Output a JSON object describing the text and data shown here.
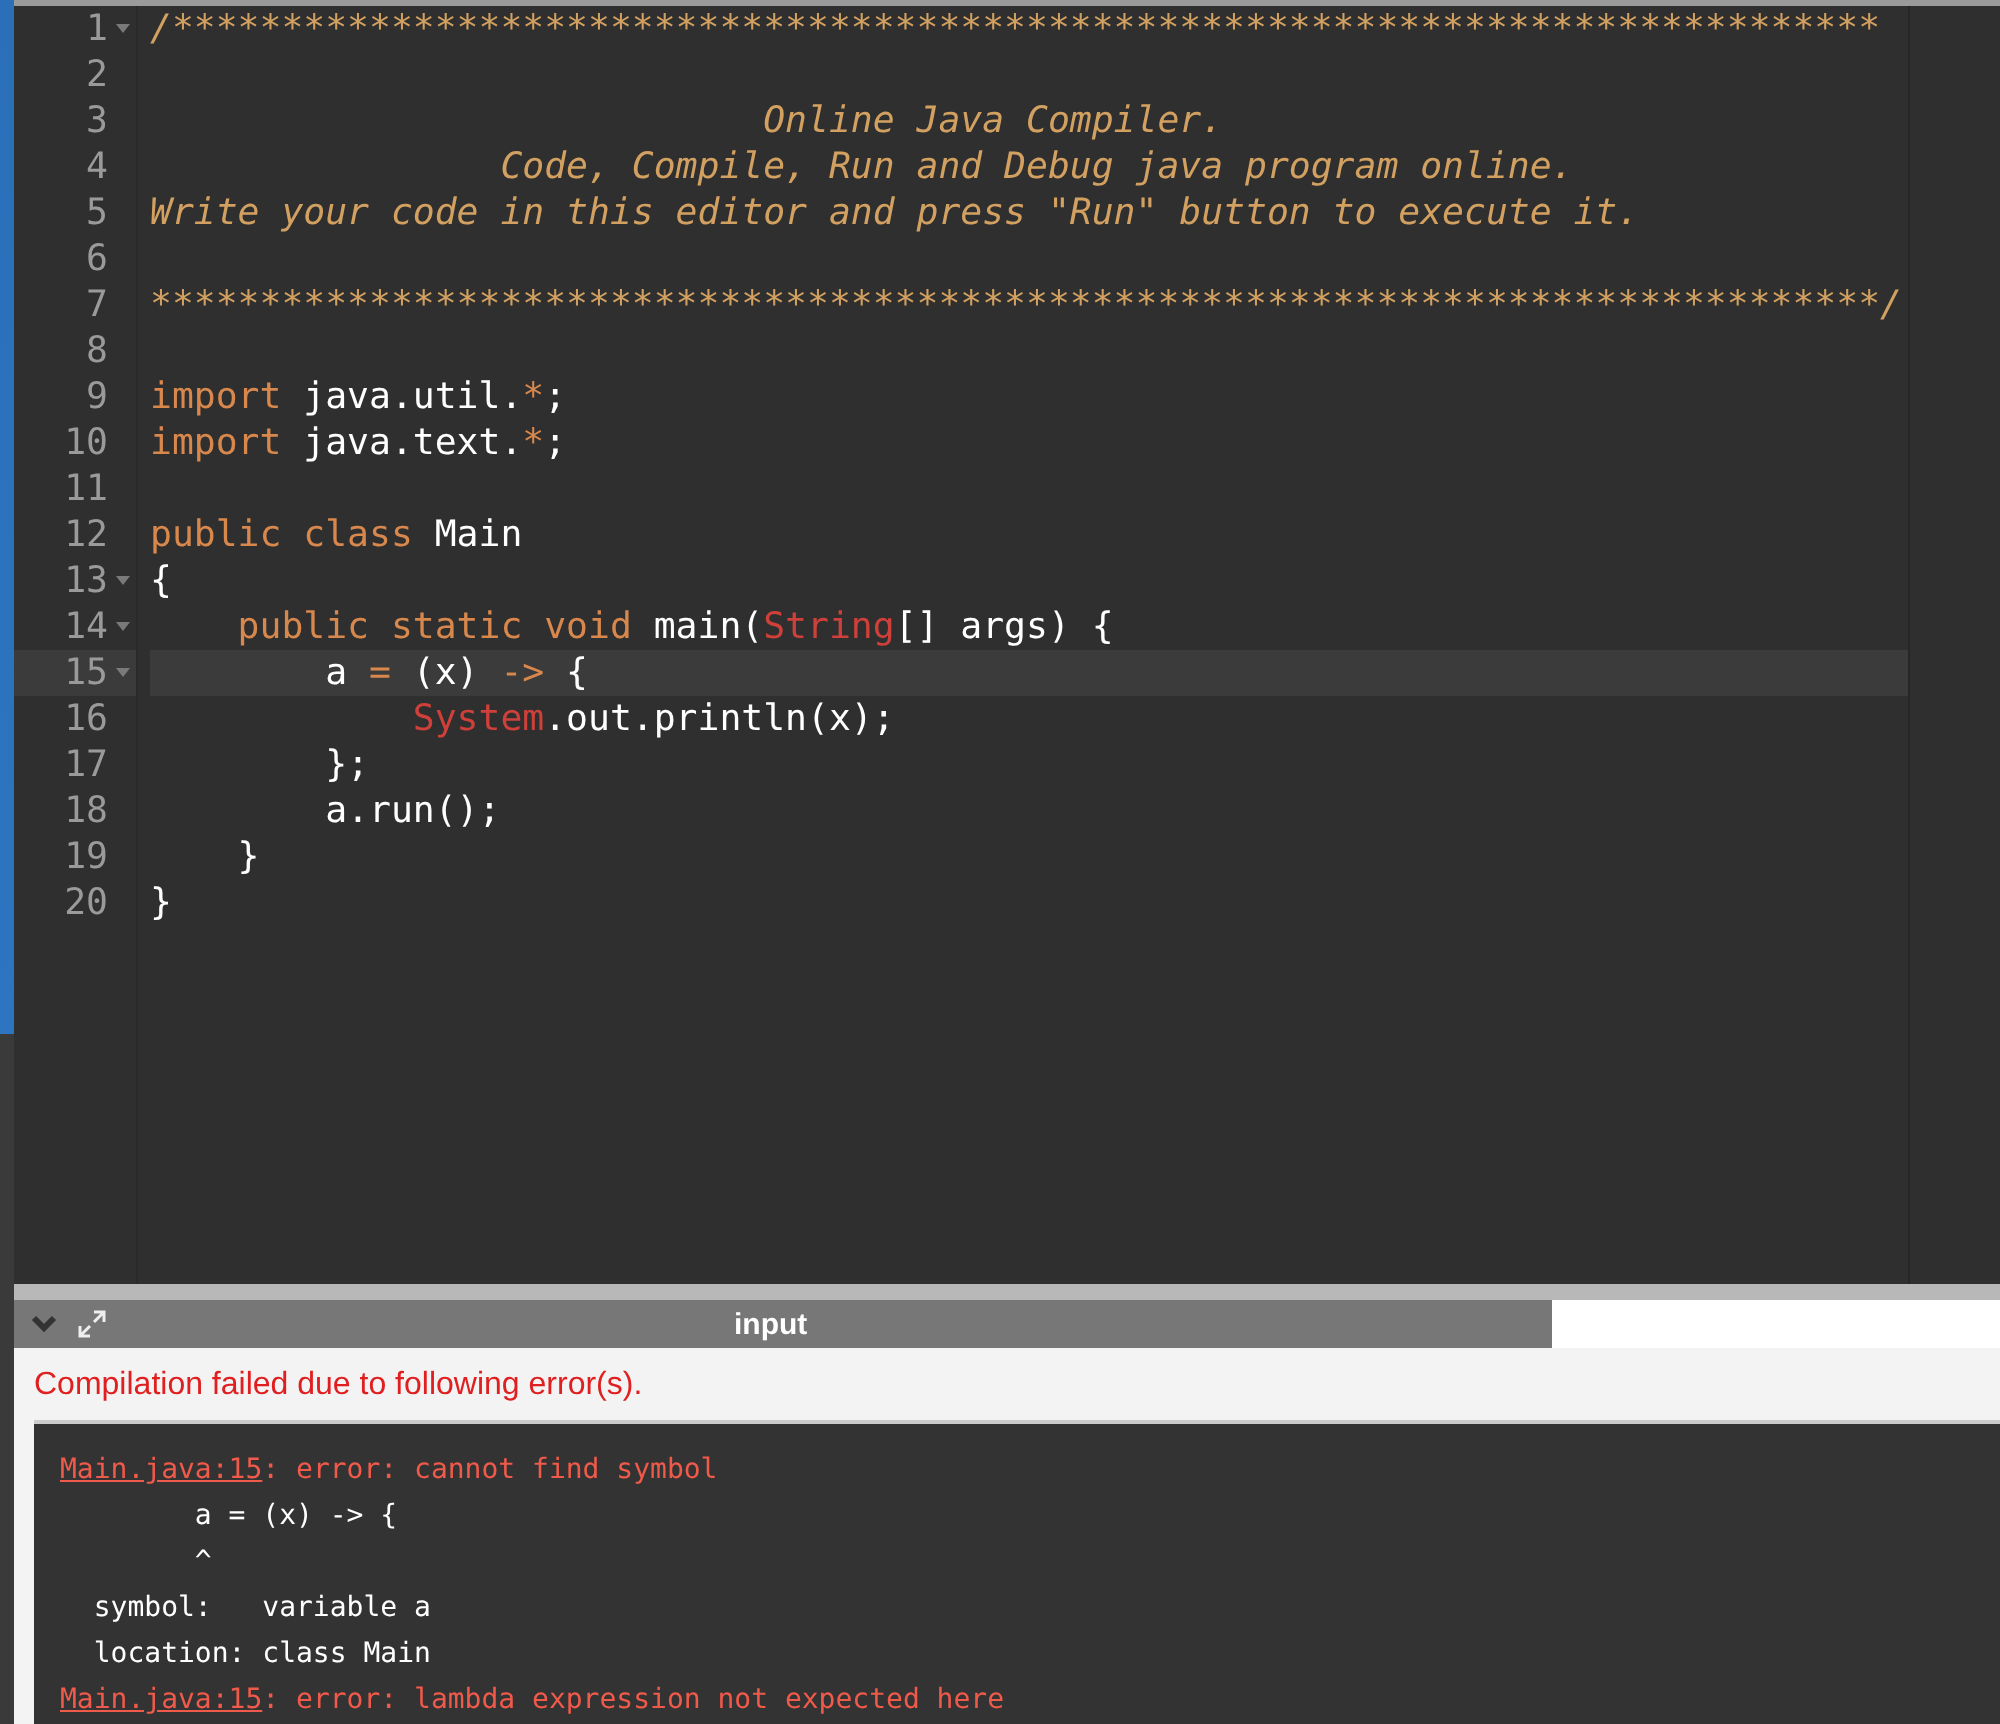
{
  "editor": {
    "lines": [
      {
        "number": "1",
        "foldable": true,
        "active": false,
        "tokens": [
          {
            "kind": "comment",
            "text": "/******************************************************************************"
          }
        ]
      },
      {
        "number": "2",
        "foldable": false,
        "active": false
      },
      {
        "number": "3",
        "foldable": false,
        "active": false,
        "tokens": [
          {
            "kind": "comment",
            "text": "                            Online Java Compiler."
          }
        ]
      },
      {
        "number": "4",
        "foldable": false,
        "active": false,
        "tokens": [
          {
            "kind": "comment",
            "text": "                Code, Compile, Run and Debug java program online."
          }
        ]
      },
      {
        "number": "5",
        "foldable": false,
        "active": false,
        "tokens": [
          {
            "kind": "comment",
            "text": "Write your code in this editor and press \"Run\" button to execute it."
          }
        ]
      },
      {
        "number": "6",
        "foldable": false,
        "active": false
      },
      {
        "number": "7",
        "foldable": false,
        "active": false,
        "tokens": [
          {
            "kind": "comment",
            "text": "*******************************************************************************/"
          }
        ]
      },
      {
        "number": "8",
        "foldable": false,
        "active": false
      },
      {
        "number": "9",
        "foldable": false,
        "active": false,
        "tokens": [
          {
            "kind": "keyword",
            "text": "import"
          },
          {
            "kind": "plain",
            "text": " java.util."
          },
          {
            "kind": "operator",
            "text": "*"
          },
          {
            "kind": "plain",
            "text": ";"
          }
        ]
      },
      {
        "number": "10",
        "foldable": false,
        "active": false,
        "tokens": [
          {
            "kind": "keyword",
            "text": "import"
          },
          {
            "kind": "plain",
            "text": " java.text."
          },
          {
            "kind": "operator",
            "text": "*"
          },
          {
            "kind": "plain",
            "text": ";"
          }
        ]
      },
      {
        "number": "11",
        "foldable": false,
        "active": false
      },
      {
        "number": "12",
        "foldable": false,
        "active": false,
        "tokens": [
          {
            "kind": "keyword",
            "text": "public class"
          },
          {
            "kind": "plain",
            "text": " Main"
          }
        ]
      },
      {
        "number": "13",
        "foldable": true,
        "active": false,
        "tokens": [
          {
            "kind": "plain",
            "text": "{"
          }
        ]
      },
      {
        "number": "14",
        "foldable": true,
        "active": false,
        "tokens": [
          {
            "kind": "keyword",
            "text": "    public static void"
          },
          {
            "kind": "plain",
            "text": " main("
          },
          {
            "kind": "type",
            "text": "String"
          },
          {
            "kind": "plain",
            "text": "[] args) {"
          }
        ]
      },
      {
        "number": "15",
        "foldable": true,
        "active": true,
        "tokens": [
          {
            "kind": "plain",
            "text": "        a "
          },
          {
            "kind": "operator",
            "text": "="
          },
          {
            "kind": "plain",
            "text": " (x) "
          },
          {
            "kind": "operator",
            "text": "->"
          },
          {
            "kind": "plain",
            "text": " {"
          }
        ]
      },
      {
        "number": "16",
        "foldable": false,
        "active": false,
        "tokens": [
          {
            "kind": "type",
            "text": "            System"
          },
          {
            "kind": "plain",
            "text": ".out.println(x);"
          }
        ]
      },
      {
        "number": "17",
        "foldable": false,
        "active": false,
        "tokens": [
          {
            "kind": "plain",
            "text": "        };"
          }
        ]
      },
      {
        "number": "18",
        "foldable": false,
        "active": false,
        "tokens": [
          {
            "kind": "plain",
            "text": "        a.run();"
          }
        ]
      },
      {
        "number": "19",
        "foldable": false,
        "active": false,
        "tokens": [
          {
            "kind": "plain",
            "text": "    }"
          }
        ]
      },
      {
        "number": "20",
        "foldable": false,
        "active": false,
        "tokens": [
          {
            "kind": "plain",
            "text": "}"
          }
        ]
      }
    ]
  },
  "panel": {
    "title": "input"
  },
  "output": {
    "status": "Compilation failed due to following error(s).",
    "lines": [
      [
        {
          "kind": "link",
          "text": "Main.java:15"
        },
        {
          "kind": "error",
          "text": ": error: cannot find symbol"
        }
      ],
      [
        {
          "kind": "plain",
          "text": "        a = (x) -> {"
        }
      ],
      [
        {
          "kind": "plain",
          "text": "        ^"
        }
      ],
      [
        {
          "kind": "plain",
          "text": "  symbol:   variable a"
        }
      ],
      [
        {
          "kind": "plain",
          "text": "  location: class Main"
        }
      ],
      [
        {
          "kind": "link",
          "text": "Main.java:15"
        },
        {
          "kind": "error",
          "text": ": error: lambda expression not expected here"
        }
      ]
    ]
  }
}
